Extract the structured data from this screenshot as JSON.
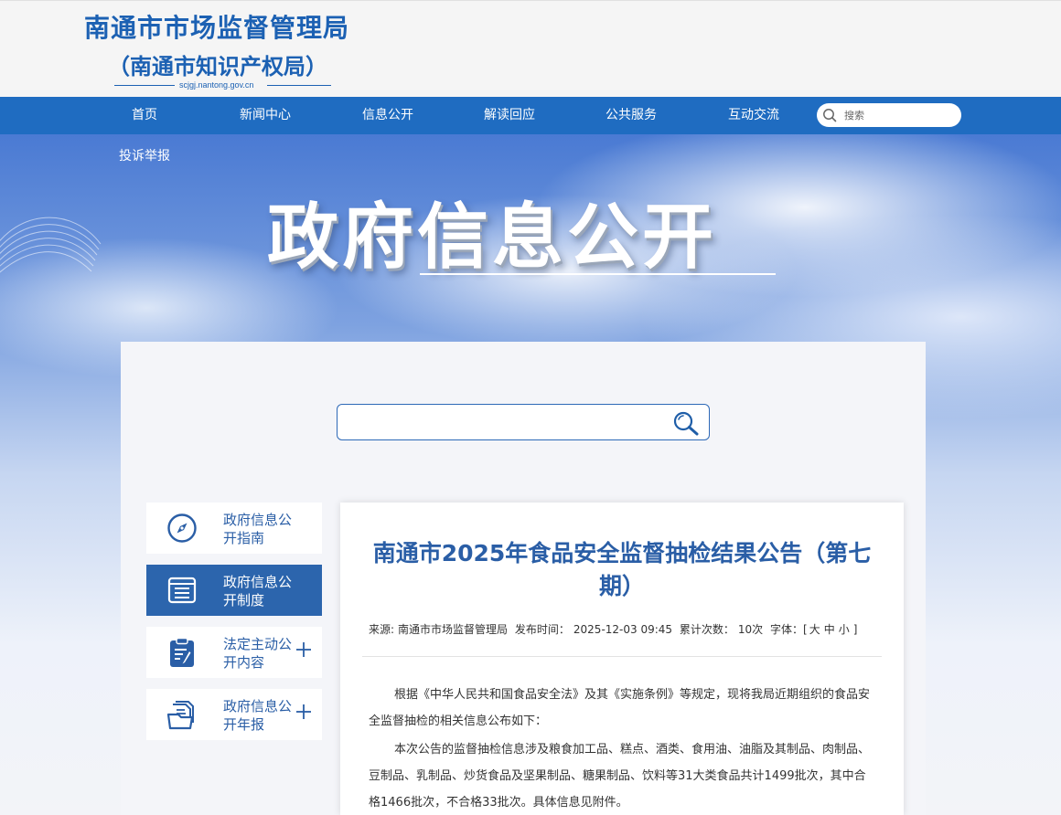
{
  "header": {
    "title": "南通市市场监督管理局",
    "subtitle": "（南通市知识产权局）",
    "domain": "scjgj.nantong.gov.cn"
  },
  "nav": {
    "items": [
      {
        "label": "首页"
      },
      {
        "label": "新闻中心"
      },
      {
        "label": "信息公开"
      },
      {
        "label": "解读回应"
      },
      {
        "label": "公共服务"
      },
      {
        "label": "互动交流"
      }
    ],
    "search_placeholder": "搜索",
    "sub_link": "投诉举报"
  },
  "banner": {
    "title": "政府信息公开"
  },
  "main_search": {
    "placeholder": ""
  },
  "sidebar": {
    "items": [
      {
        "label": "政府信息公开指南",
        "icon": "compass-icon",
        "active": false,
        "expandable": false
      },
      {
        "label": "政府信息公开制度",
        "icon": "document-list-icon",
        "active": true,
        "expandable": false
      },
      {
        "label": "法定主动公开内容",
        "icon": "clipboard-icon",
        "active": false,
        "expandable": true
      },
      {
        "label": "政府信息公开年报",
        "icon": "folder-icon",
        "active": false,
        "expandable": true
      }
    ]
  },
  "article": {
    "title": "南通市2025年食品安全监督抽检结果公告（第七期）",
    "source_label": "来源:",
    "source": "南通市市场监督管理局",
    "publish_label": "发布时间：",
    "publish_time": "2025-12-03 09:45",
    "views_label": "累计次数：",
    "views": "10次",
    "font_label": "字体：[",
    "font_large": "大",
    "font_medium": "中",
    "font_small": "小",
    "font_end": "]",
    "paragraphs": [
      "根据《中华人民共和国食品安全法》及其《实施条例》等规定，现将我局近期组织的食品安全监督抽检的相关信息公布如下：",
      "本次公告的监督抽检信息涉及粮食加工品、糕点、酒类、食用油、油脂及其制品、肉制品、豆制品、乳制品、炒货食品及坚果制品、糖果制品、饮料等31大类食品共计1499批次，其中合格1466批次，不合格33批次。具体信息见附件。"
    ]
  },
  "colors": {
    "brand_blue": "#1c61b3",
    "nav_blue": "#1f6cc1",
    "active_blue": "#2c65ad"
  }
}
